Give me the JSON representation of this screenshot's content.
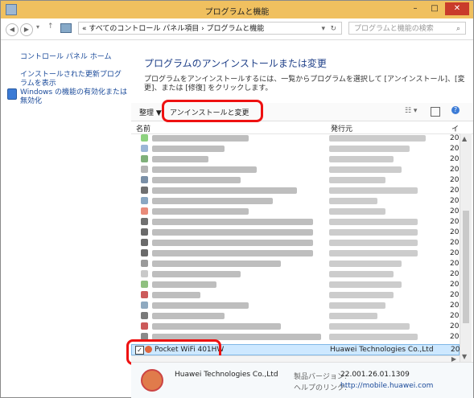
{
  "window": {
    "title": "プログラムと機能",
    "min_glyph": "–",
    "max_glyph": "□",
    "close_glyph": "✕"
  },
  "address": {
    "path": "« すべてのコントロール パネル項目  ›  プログラムと機能",
    "search_placeholder": "プログラムと機能の検索"
  },
  "left_pane": {
    "items": [
      {
        "label": "コントロール パネル ホーム"
      },
      {
        "label": "インストールされた更新プログラムを表示"
      },
      {
        "label": "Windows の機能の有効化または無効化"
      }
    ]
  },
  "main": {
    "heading": "プログラムのアンインストールまたは変更",
    "description": "プログラムをアンインストールするには、一覧からプログラムを選択して [アンインストール]、[変更]、または [修復] をクリックします。",
    "toolbar": {
      "organize": "整理 ▼",
      "uninstall_change": "アンインストールと変更"
    },
    "columns": {
      "name": "名前",
      "publisher": "発行元",
      "install": "イ"
    },
    "selected_row": {
      "name": "Pocket WiFi 401HW",
      "publisher": "Huawei Technologies Co.,Ltd",
      "install": "20"
    },
    "bottom": {
      "publisher": "Huawei Technologies Co.,Ltd",
      "version_label": "製品バージョン:",
      "version": "22.001.26.01.1309",
      "help_label": "ヘルプのリンク:",
      "help_link": "http://mobile.huawei.com"
    }
  },
  "colors": {
    "titlebar": "#f0c05f",
    "heading": "#1e3f88",
    "highlight": "#e11111"
  },
  "installed_on_glyph": "20"
}
